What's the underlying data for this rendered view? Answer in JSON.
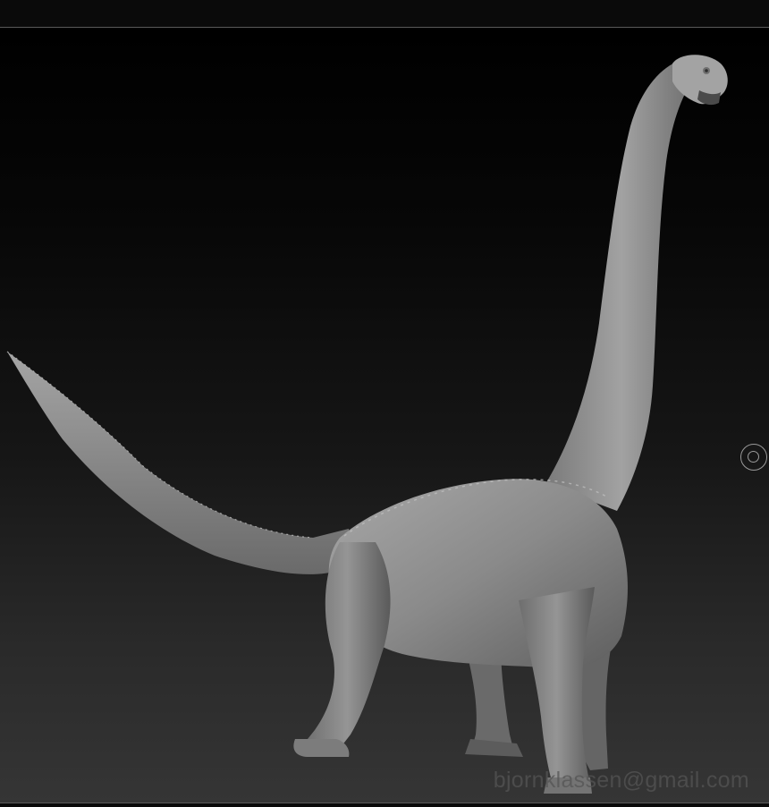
{
  "viewport": {
    "background_top": "#000000",
    "background_bottom": "#353535",
    "model_color": "#8c8c8c",
    "model_subject": "sauropod-sculpt",
    "pivot_icon": "pivot-handle-icon"
  },
  "watermark": {
    "text": "bjornklassen@gmail.com"
  }
}
